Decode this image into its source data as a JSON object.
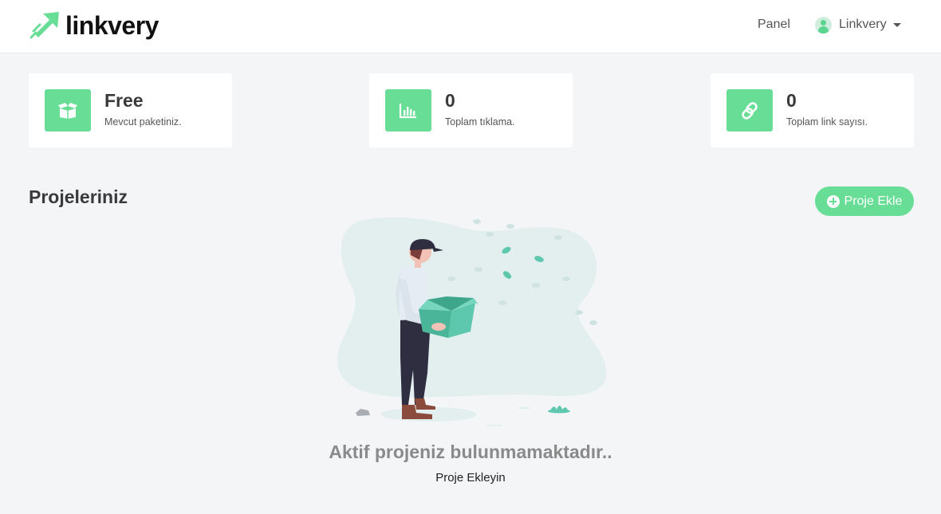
{
  "brand": {
    "name": "linkvery",
    "icon": "arrow-up-right-icon",
    "accent": "#68dd96"
  },
  "nav": {
    "panel": "Panel",
    "user": "Linkvery"
  },
  "stats": [
    {
      "value": "Free",
      "label": "Mevcut paketiniz.",
      "icon": "box-icon"
    },
    {
      "value": "0",
      "label": "Toplam tıklama.",
      "icon": "bar-chart-icon"
    },
    {
      "value": "0",
      "label": "Toplam link sayısı.",
      "icon": "link-icon"
    }
  ],
  "projects": {
    "title": "Projeleriniz",
    "add_label": "Proje Ekle",
    "empty_title": "Aktif projeniz bulunmamaktadır..",
    "empty_subtitle": "Proje Ekleyin"
  }
}
